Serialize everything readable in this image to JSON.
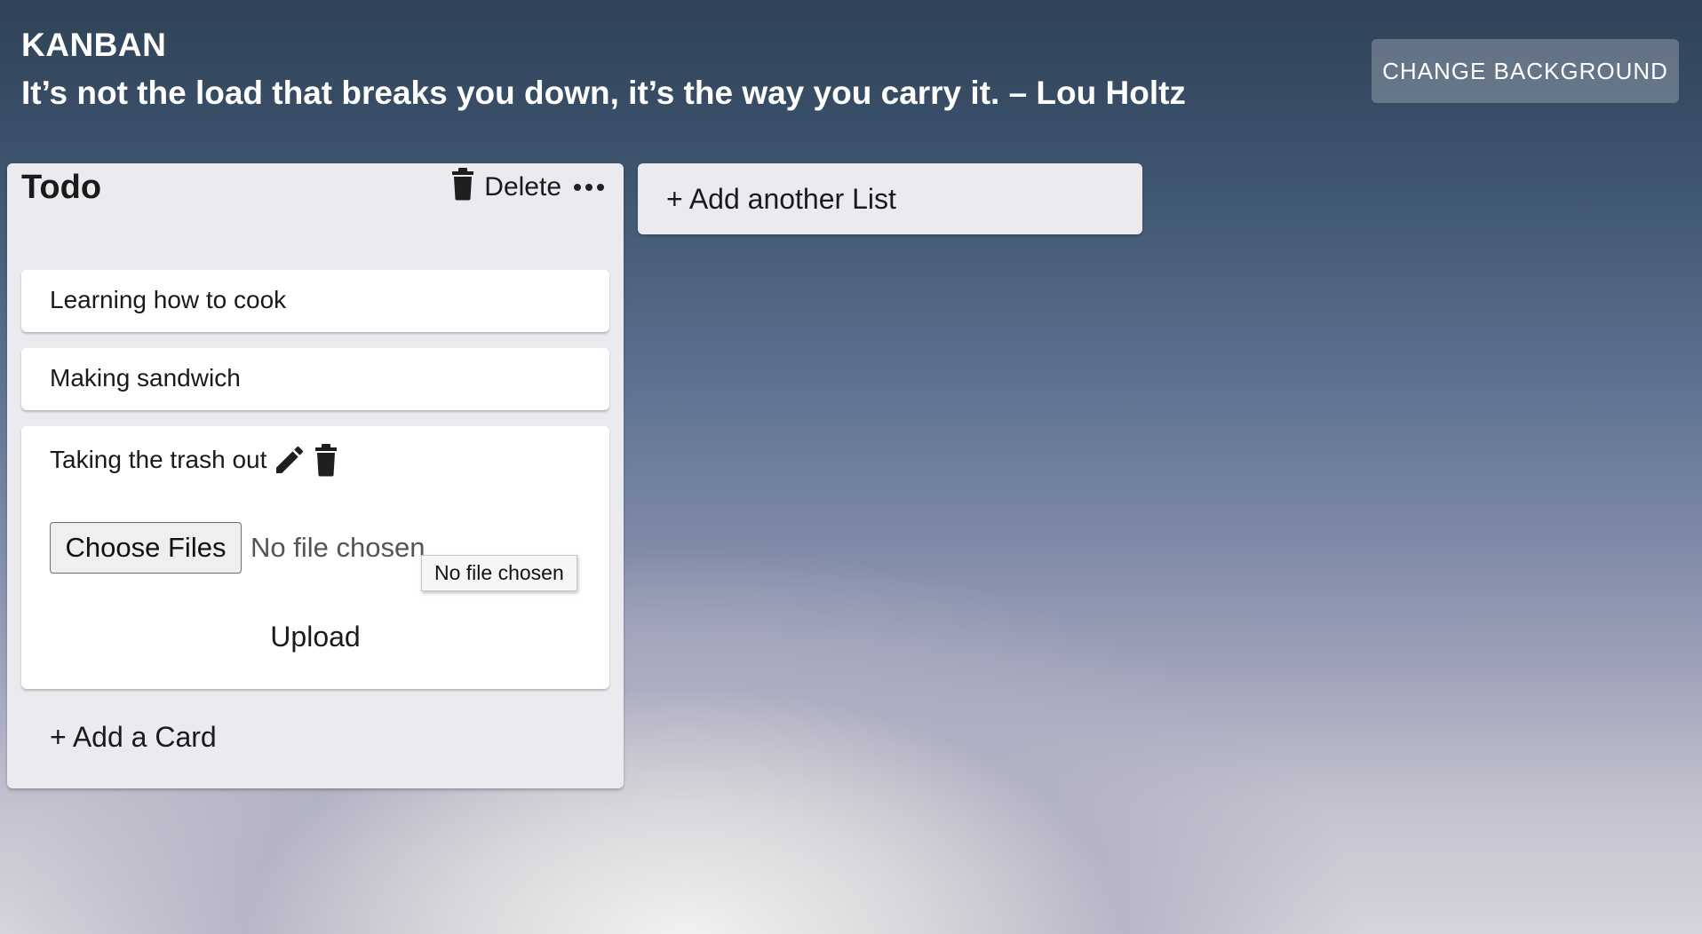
{
  "header": {
    "app_title": "KANBAN",
    "quote": "It’s not the load that breaks you down, it’s the way you carry it. – Lou Holtz",
    "change_background_label": "CHANGE BACKGROUND"
  },
  "lists": [
    {
      "title": "Todo",
      "delete_label": "Delete",
      "cards": [
        {
          "text": "Learning how to cook"
        },
        {
          "text": "Making sandwich"
        },
        {
          "text": "Taking the trash out",
          "edit_icon": "pencil-icon",
          "delete_icon": "trash-icon",
          "file_button_label": "Choose Files",
          "file_status": "No file chosen",
          "tooltip": "No file chosen",
          "upload_label": "Upload"
        }
      ],
      "add_card_label": "+ Add a Card"
    }
  ],
  "add_list_label": "+ Add another List"
}
